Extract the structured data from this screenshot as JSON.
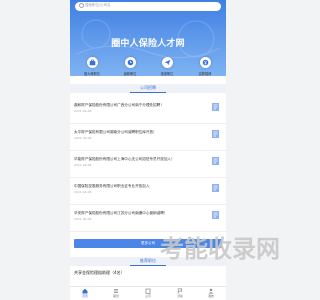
{
  "search": {
    "placeholder": "搜索职位/公司名"
  },
  "hero": {
    "title": "圈中人保险人才网"
  },
  "quick_links": [
    {
      "label": "推大荐职位",
      "icon": "briefcase-icon"
    },
    {
      "label": "最新职位",
      "icon": "clock-icon"
    },
    {
      "label": "投递职位",
      "icon": "send-icon"
    },
    {
      "label": "高薪推荐",
      "icon": "money-icon"
    }
  ],
  "company_section": {
    "title": "公司招聘"
  },
  "news": [
    {
      "title": "鼎和财产保险股份有限公司广西分公司南宁分理处招聘！",
      "date": "2021-04-06"
    },
    {
      "title": "太平财产保险有限公司湖南分公司诚聘职位库开放！",
      "date": "2021-04-06"
    },
    {
      "title": "华能财产保险股份有限公司上海中心支公司招驻专员开放加入！",
      "date": "2021-04-06"
    },
    {
      "title": "中国保险控股服务有限公司职业证专业开放加入",
      "date": "2021-04-06"
    },
    {
      "title": "华安财产保险股份有限公司江苏分公司南通中心营销诚聘！",
      "date": "2021-04-06"
    }
  ],
  "more_button": {
    "label": "更多公司"
  },
  "job_section": {
    "title": "推荐职位"
  },
  "job_row": {
    "text": "共享金保险理赔助理（4名）"
  },
  "tabbar": [
    {
      "label": "首页",
      "icon": "home-icon"
    },
    {
      "label": "职位",
      "icon": "list-icon"
    },
    {
      "label": "公司",
      "icon": "building-icon"
    },
    {
      "label": "活动",
      "icon": "flag-icon"
    },
    {
      "label": "我的",
      "icon": "user-icon"
    }
  ],
  "watermark": {
    "text": "考能收录网"
  },
  "colors": {
    "accent": "#3a6fd8",
    "hero_top": "#3f7fe3",
    "hero_bottom": "#7fb3f2",
    "button": "#4a86e8"
  }
}
